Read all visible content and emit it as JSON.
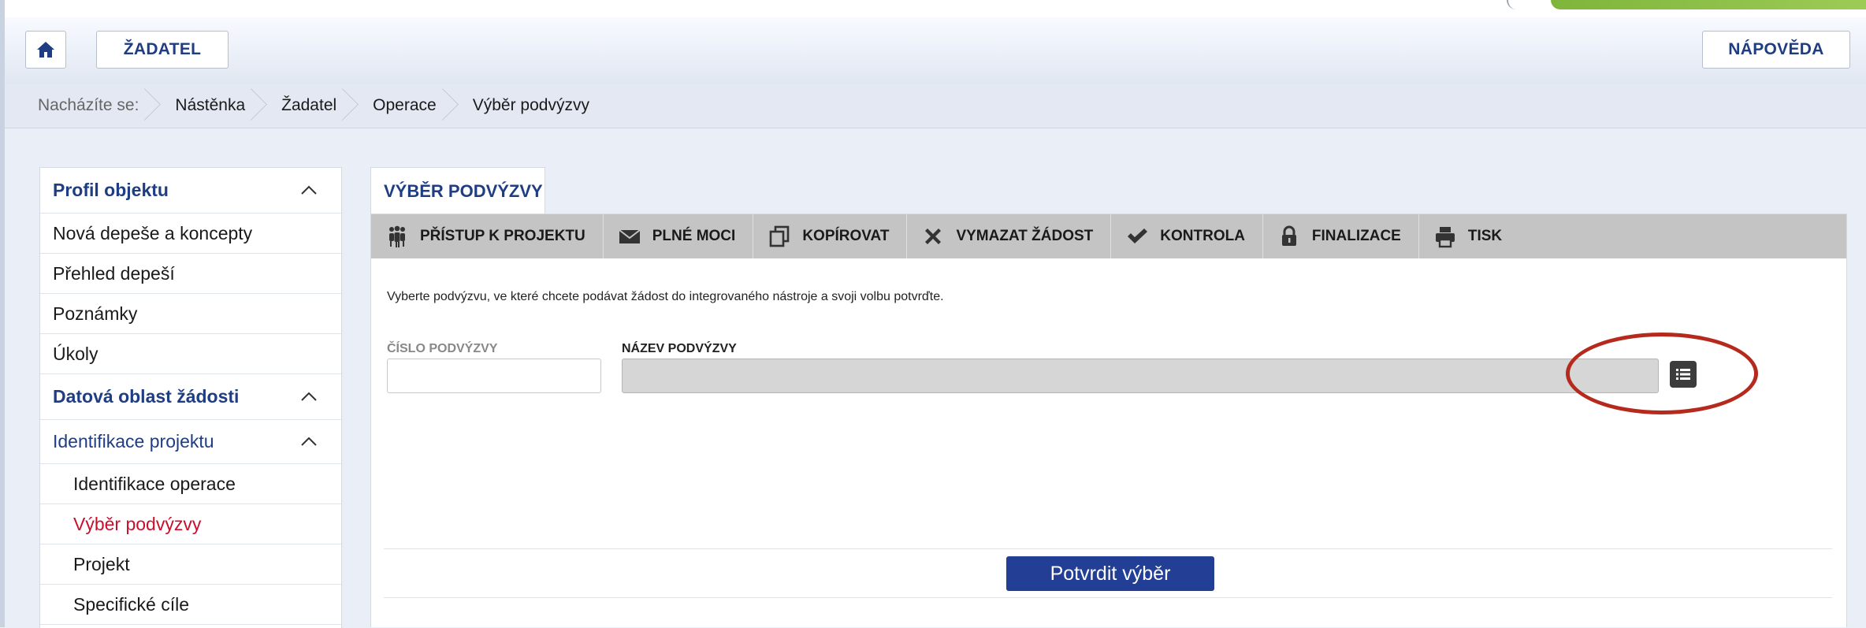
{
  "header": {
    "home_icon": "home-icon",
    "zadatel_label": "ŽADATEL",
    "napoveda_label": "NÁPOVĚDA"
  },
  "breadcrumb": {
    "label": "Nacházíte se:",
    "items": [
      "Nástěnka",
      "Žadatel",
      "Operace",
      "Výběr podvýzvy"
    ]
  },
  "sidebar": {
    "profil": "Profil objektu",
    "items": [
      "Nová depeše a koncepty",
      "Přehled depeší",
      "Poznámky",
      "Úkoly"
    ],
    "datova": "Datová oblast žádosti",
    "identifikace": "Identifikace projektu",
    "sub_items": [
      "Identifikace operace",
      "Výběr podvýzvy",
      "Projekt",
      "Specifické cíle"
    ],
    "active_item": "Výběr podvýzvy"
  },
  "main": {
    "tab_title": "VÝBĚR PODVÝZVY",
    "toolbar": [
      {
        "label": "PŘÍSTUP K PROJEKTU",
        "icon": "people-icon"
      },
      {
        "label": "PLNÉ MOCI",
        "icon": "envelope-icon"
      },
      {
        "label": "KOPÍROVAT",
        "icon": "copy-icon"
      },
      {
        "label": "VYMAZAT ŽÁDOST",
        "icon": "close-icon"
      },
      {
        "label": "KONTROLA",
        "icon": "check-icon"
      },
      {
        "label": "FINALIZACE",
        "icon": "lock-icon"
      },
      {
        "label": "TISK",
        "icon": "printer-icon"
      }
    ],
    "instruction": "Vyberte podvýzvu, ve které chcete podávat žádost do integrovaného nástroje a svoji volbu potvrďte.",
    "cislo_label": "ČÍSLO PODVÝZVY",
    "cislo_value": "",
    "nazev_label": "NÁZEV PODVÝZVY",
    "nazev_value": "",
    "list_icon": "list-icon",
    "confirm_label": "Potvrdit výběr"
  },
  "colors": {
    "brand_blue": "#1f3d82",
    "button_blue": "#233f95",
    "active_red": "#c8102e",
    "annotation_red": "#b52a1c",
    "toolbar_gray": "#c4c4c4"
  }
}
